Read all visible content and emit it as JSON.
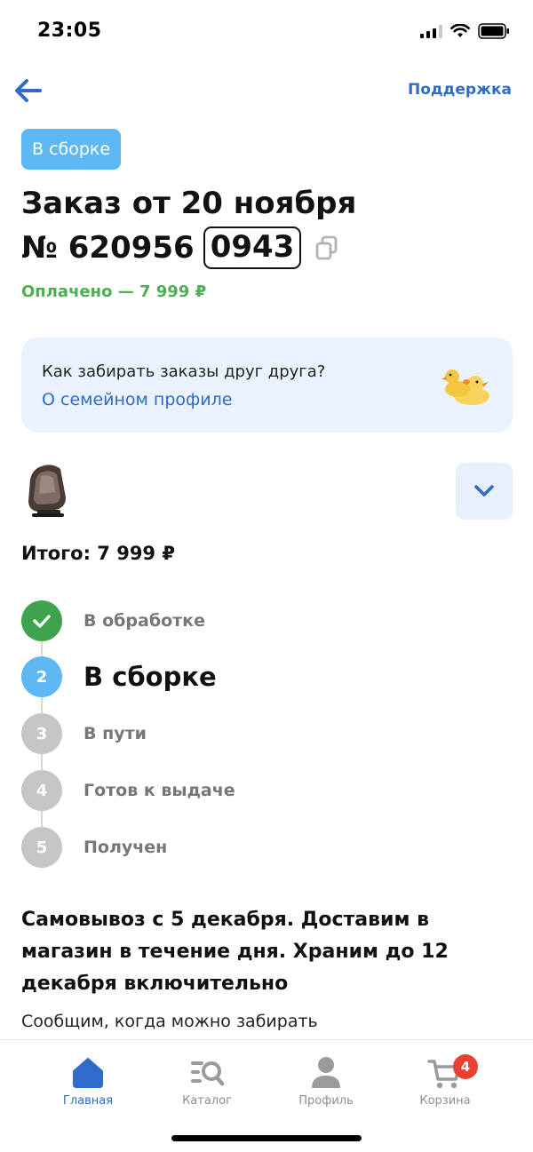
{
  "status_bar": {
    "time": "23:05"
  },
  "nav": {
    "back_icon": "arrow-left-icon",
    "support_label": "Поддержка"
  },
  "order": {
    "status_chip": "В сборке",
    "title": "Заказ от 20 ноября",
    "number_prefix": "№ 620956",
    "number_code": "0943",
    "paid_text": "Оплачено — 7 999 ₽"
  },
  "family_card": {
    "question": "Как забирать заказы друг друга?",
    "link": "О семейном профиле",
    "icon": "ducks-icon"
  },
  "product": {
    "image": "car-seat-image",
    "total": "Итого: 7 999 ₽"
  },
  "steps": [
    {
      "number": "",
      "label": "В обработке",
      "state": "done",
      "color": "#3fa34d"
    },
    {
      "number": "2",
      "label": "В сборке",
      "state": "current",
      "color": "#5eb8f4"
    },
    {
      "number": "3",
      "label": "В пути",
      "state": "pending",
      "color": "#c6c6c6"
    },
    {
      "number": "4",
      "label": "Готов к выдаче",
      "state": "pending",
      "color": "#c6c6c6"
    },
    {
      "number": "5",
      "label": "Получен",
      "state": "pending",
      "color": "#c6c6c6"
    }
  ],
  "pickup": {
    "title": "Самовывоз с 5 декабря. Доставим в магазин в течение дня. Храним до 12 декабря включительно",
    "note": "Сообщим, когда можно забирать"
  },
  "tab_bar": {
    "items": [
      {
        "label": "Главная",
        "icon": "home-icon",
        "active": true
      },
      {
        "label": "Каталог",
        "icon": "catalog-search-icon",
        "active": false
      },
      {
        "label": "Профиль",
        "icon": "profile-icon",
        "active": false
      },
      {
        "label": "Корзина",
        "icon": "cart-icon",
        "active": false,
        "badge": "4"
      }
    ]
  },
  "colors": {
    "accent": "#2f6bc9",
    "paid": "#4caf50",
    "chip": "#5eb8f4",
    "badge": "#e8412f"
  }
}
